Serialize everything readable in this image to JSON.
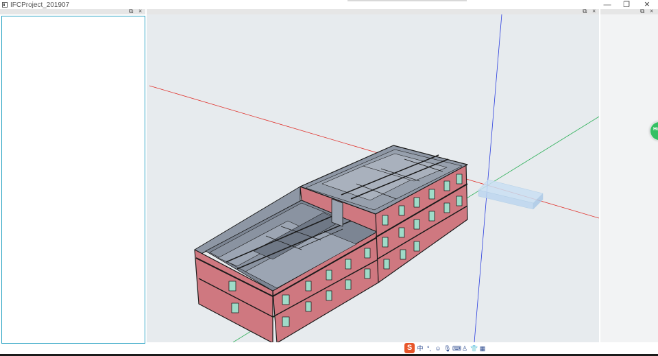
{
  "window": {
    "title": "IFCProject_201907",
    "controls": {
      "minimize": "—",
      "restore": "❐",
      "close": "✕"
    }
  },
  "docks": {
    "left": {
      "float": "⧉",
      "close": "×"
    },
    "viewport": {
      "float": "⧉",
      "close": "×"
    },
    "right": {
      "float": "⧉",
      "close": "×"
    }
  },
  "floating_button": {
    "label": "Ho"
  },
  "ime_bar": {
    "logo": "S",
    "items": [
      {
        "icon": "chinese-mode-icon",
        "glyph": "中"
      },
      {
        "icon": "punctuation-icon",
        "glyph": "°,"
      },
      {
        "icon": "emoji-icon",
        "glyph": "☺"
      },
      {
        "icon": "microphone-icon",
        "glyph": "🎙"
      },
      {
        "icon": "keyboard-icon",
        "glyph": "⌨"
      },
      {
        "icon": "person-icon",
        "glyph": "♙"
      },
      {
        "icon": "skin-icon",
        "glyph": "👕"
      },
      {
        "icon": "toolbox-icon",
        "glyph": "▦"
      }
    ]
  },
  "colors": {
    "facade": "#cf7880",
    "roof": "#8e97a5",
    "window_glass": "#9fdbc8",
    "axis_x": "#e0302a",
    "axis_y": "#2fb05a",
    "axis_z": "#2a3de0",
    "viewport_bg": "#e7ebee",
    "selection_border": "#2aa3c4"
  }
}
